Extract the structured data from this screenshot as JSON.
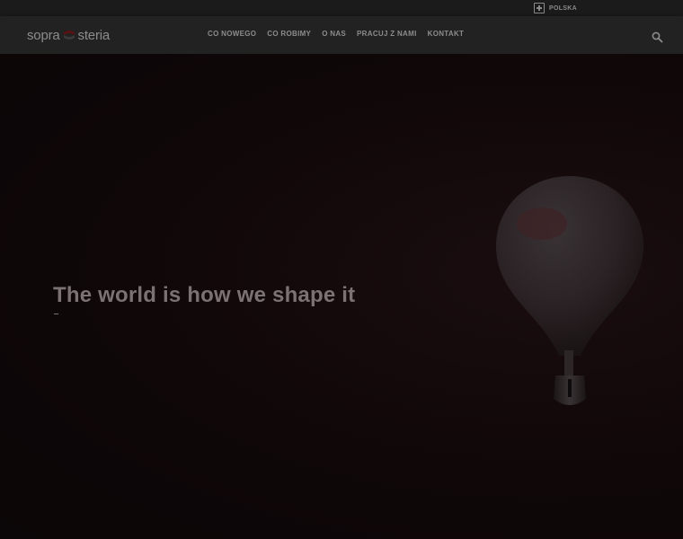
{
  "topbar": {
    "region_label": "POLSKA",
    "region_icon": "plus-square-icon"
  },
  "header": {
    "logo_left": "sopra",
    "logo_right": "steria",
    "logo_icon": "sopra-steria-logo-mark",
    "nav": [
      {
        "label": "CO NOWEGO"
      },
      {
        "label": "CO ROBIMY"
      },
      {
        "label": "O NAS"
      },
      {
        "label": "PRACUJ Z NAMI"
      },
      {
        "label": "KONTAKT"
      }
    ],
    "search_icon": "search-icon"
  },
  "hero": {
    "title": "The world is how we shape it",
    "image": "light-bulb-illustration"
  },
  "colors": {
    "background": "#0c0708",
    "header": "#222223",
    "topbar": "#1b1b1c",
    "text": "#8c8c8c",
    "accent": "#5a1212"
  }
}
